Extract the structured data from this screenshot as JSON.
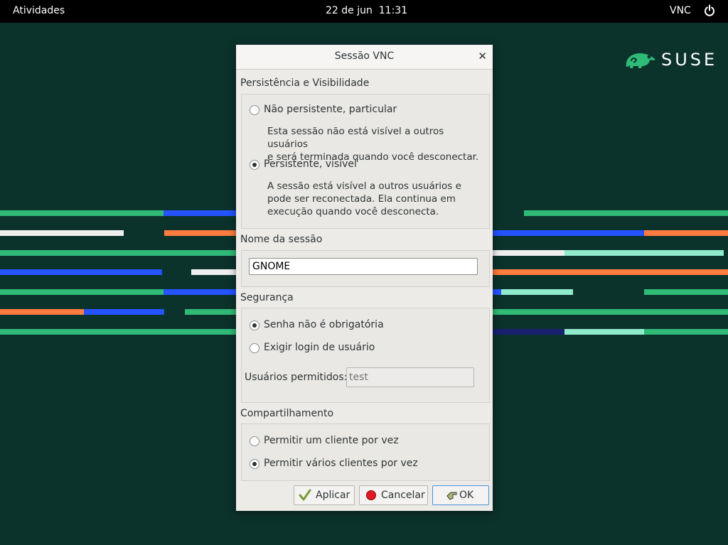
{
  "topbar": {
    "activities": "Atividades",
    "date": "22 de jun",
    "time": "11:31",
    "vnc": "VNC",
    "power_icon": "power-icon"
  },
  "brand": {
    "logo_text": "SUSE",
    "color": "#30ba78"
  },
  "dialog": {
    "title": "Sessão VNC",
    "close_icon": "close-icon",
    "persistence": {
      "label": "Persistência e Visibilidade",
      "options": [
        {
          "label": "Não persistente, particular",
          "checked": false,
          "desc_lines": [
            "Esta sessão não está visível a outros usuários",
            "e será terminada quando você desconectar."
          ]
        },
        {
          "label": "Persistente, visível",
          "checked": true,
          "desc_lines": [
            "A sessão está visível a outros usuários e",
            "pode ser reconectada. Ela continua em",
            "execução quando você desconecta."
          ]
        }
      ]
    },
    "session_name": {
      "label": "Nome da sessão",
      "value": "GNOME"
    },
    "security": {
      "label": "Segurança",
      "options": [
        {
          "label": "Senha não é obrigatória",
          "checked": true
        },
        {
          "label": "Exigir login de usuário",
          "checked": false
        }
      ],
      "allowed_users_label": "Usuários permitidos:",
      "allowed_users_value": "test"
    },
    "sharing": {
      "label": "Compartilhamento",
      "options": [
        {
          "label": "Permitir um cliente por vez",
          "checked": false
        },
        {
          "label": "Permitir vários clientes por vez",
          "checked": true
        }
      ]
    },
    "buttons": {
      "apply": "Aplicar",
      "cancel": "Cancelar",
      "ok": "OK"
    }
  }
}
